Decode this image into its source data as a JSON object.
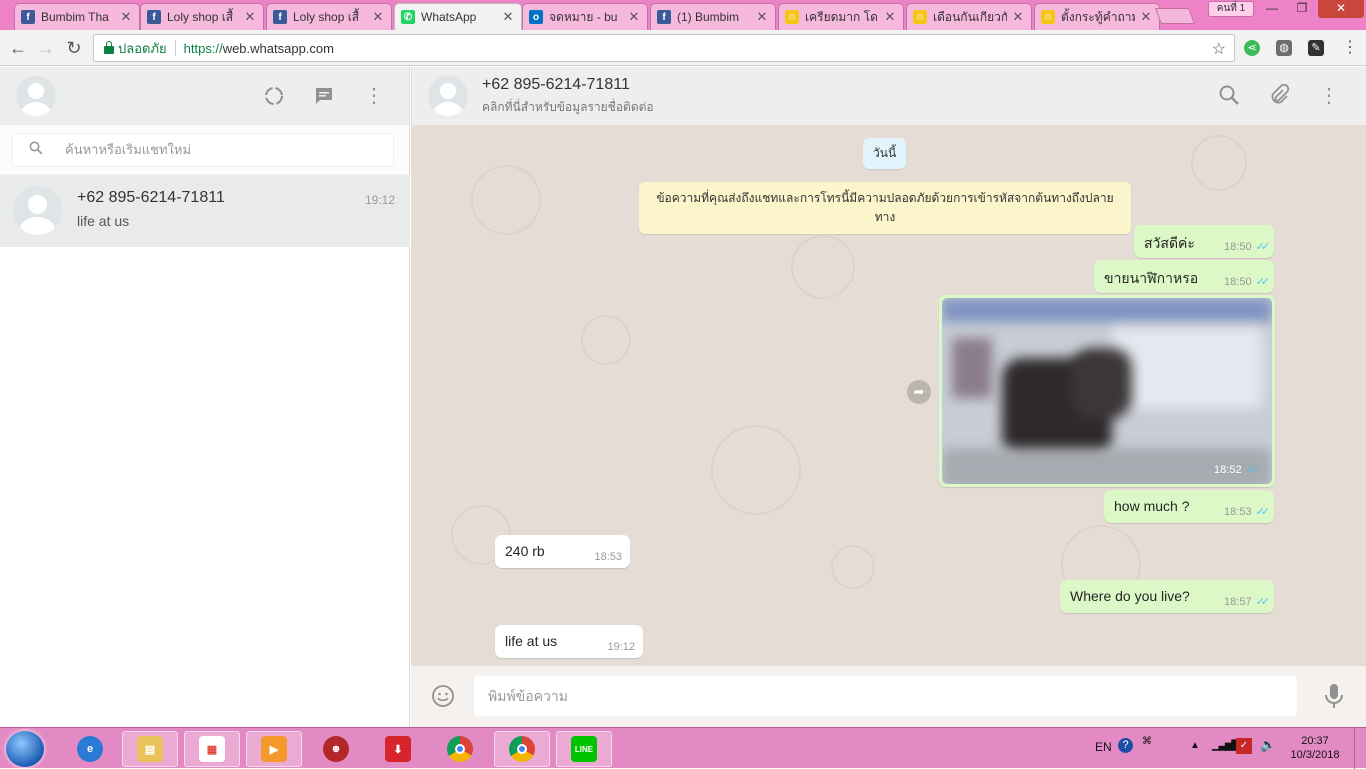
{
  "browser": {
    "tabs": [
      {
        "title": "Bumbim Tha",
        "icon": "facebook-icon"
      },
      {
        "title": "Loly shop เสื้",
        "icon": "facebook-icon"
      },
      {
        "title": "Loly shop เสื้",
        "icon": "facebook-icon"
      },
      {
        "title": "WhatsApp",
        "icon": "whatsapp-icon",
        "active": true
      },
      {
        "title": "จดหมาย - bu",
        "icon": "outlook-icon"
      },
      {
        "title": "(1) Bumbim",
        "icon": "facebook-icon"
      },
      {
        "title": "เครียดมาก โด",
        "icon": "emoji-icon"
      },
      {
        "title": "เดือนกันเกียวกั",
        "icon": "emoji-icon"
      },
      {
        "title": "ตั้งกระทู้คำถาม",
        "icon": "emoji-icon"
      }
    ],
    "user_label": "คนที่ 1",
    "secure_label": "ปลอดภัย",
    "url_scheme": "https://",
    "url_host": "web.whatsapp.com",
    "theme_color": "#ee82c6"
  },
  "sidebar": {
    "search_placeholder": "ค้นหาหรือเริ่มแชทใหม่",
    "chats": [
      {
        "name": "+62 895-6214-71811",
        "preview": "life at us",
        "time": "19:12"
      }
    ]
  },
  "conversation": {
    "contact_name": "+62 895-6214-71811",
    "contact_subtitle": "คลิกที่นี่สำหรับข้อมูลรายชื่อติดต่อ",
    "date_chip": "วันนี้",
    "encryption_notice": "ข้อความที่คุณส่งถึงแชทและการโทรนี้มีความปลอดภัยด้วยการเข้ารหัสจากต้นทางถึงปลายทาง",
    "messages": [
      {
        "dir": "out",
        "text": "สวัสดีค่ะ",
        "time": "18:50",
        "status": "read"
      },
      {
        "dir": "out",
        "text": "ขายนาฬิกาหรอ",
        "time": "18:50",
        "status": "read"
      },
      {
        "dir": "out",
        "type": "image",
        "time": "18:52",
        "status": "read"
      },
      {
        "dir": "out",
        "text": "how much ?",
        "time": "18:53",
        "status": "read"
      },
      {
        "dir": "in",
        "text": "240 rb",
        "time": "18:53"
      },
      {
        "dir": "out",
        "text": "Where do you live?",
        "time": "18:57",
        "status": "read"
      },
      {
        "dir": "in",
        "text": "life at us",
        "time": "19:12"
      }
    ],
    "composer_placeholder": "พิมพ์ข้อความ",
    "colors": {
      "outgoing": "#dcf8c6",
      "incoming": "#ffffff",
      "wallpaper": "#e5ddd5",
      "read_ticks": "#4fc3f7"
    }
  },
  "taskbar": {
    "language": "EN",
    "time": "20:37",
    "date": "10/3/2018",
    "pinned": [
      "internet-explorer-icon",
      "file-explorer-icon",
      "apps-grid-icon",
      "media-player-icon",
      "ninja-app-icon",
      "download-manager-icon",
      "chrome-icon",
      "chrome-icon",
      "line-icon"
    ]
  }
}
